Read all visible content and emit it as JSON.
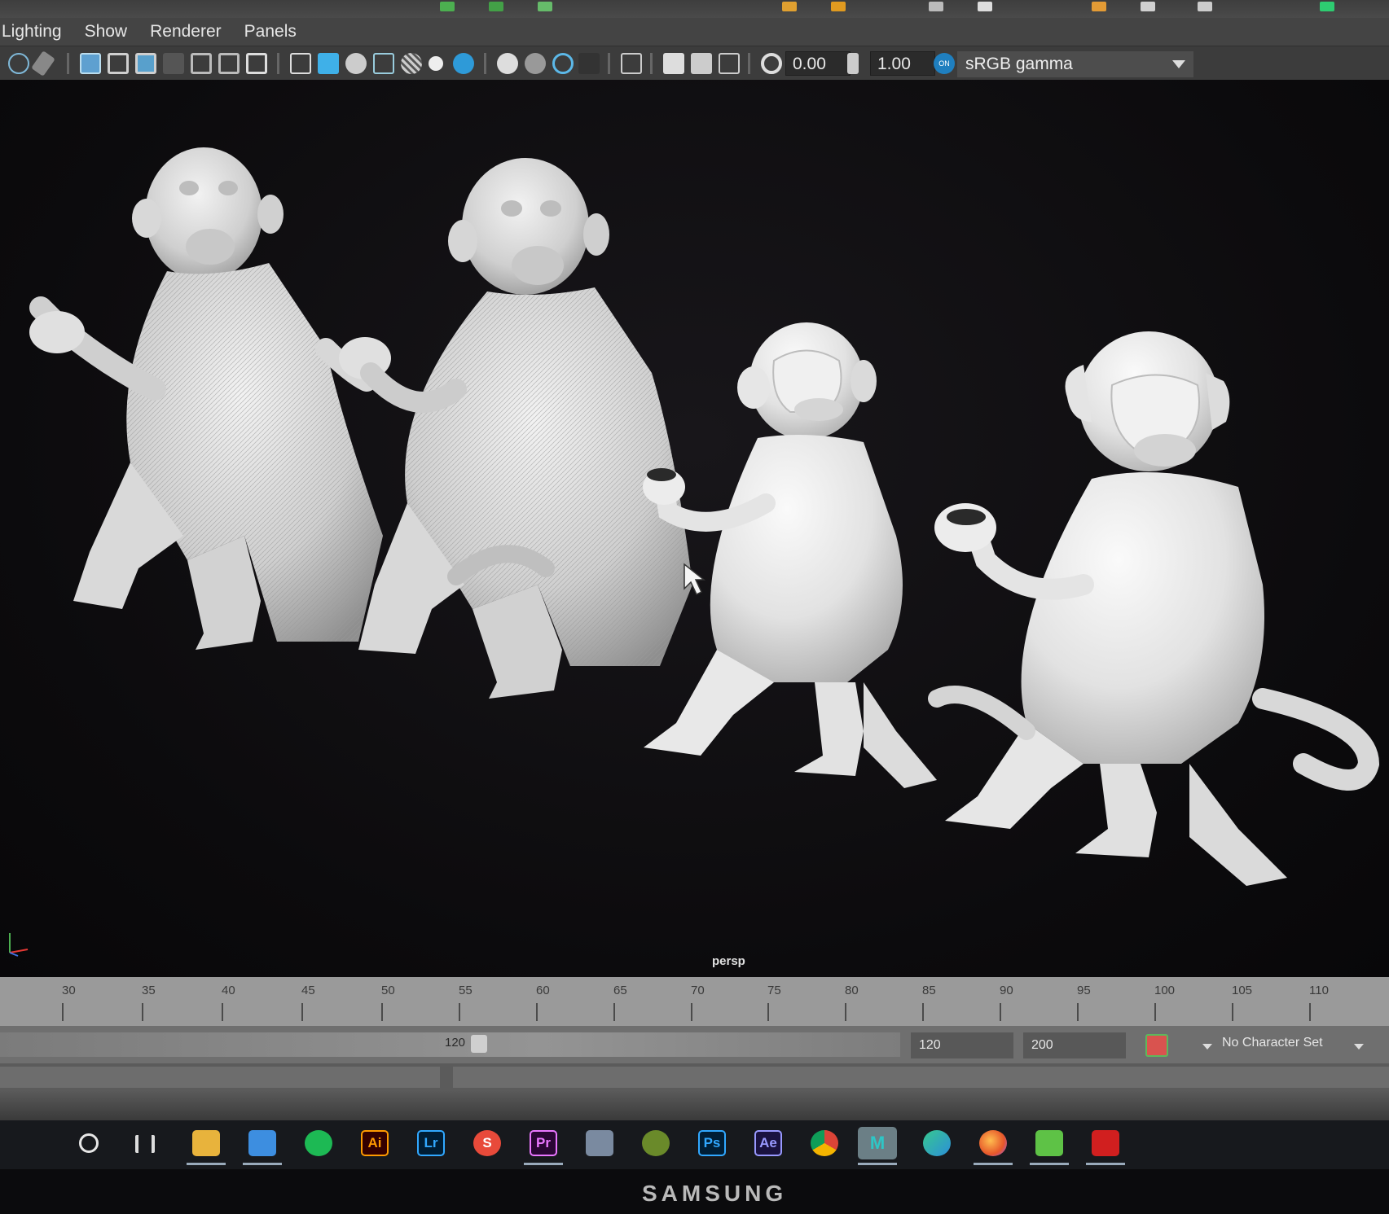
{
  "menu": {
    "items": [
      "Lighting",
      "Show",
      "Renderer",
      "Panels"
    ]
  },
  "toolbar": {
    "exposure_value": "0.00",
    "gamma_value": "1.00",
    "colorspace_badge": "ON",
    "colorspace": "sRGB gamma",
    "icons": [
      "select-camera-icon",
      "camera-attributes-icon",
      "grid-icon",
      "film-gate-icon",
      "resolution-gate-icon",
      "field-chart-icon",
      "safe-action-icon",
      "safe-title-icon",
      "wireframe-icon",
      "smooth-shade-icon",
      "default-material-icon",
      "textured-icon",
      "wireframe-on-shaded-icon",
      "lights-icon",
      "shadows-icon",
      "ambient-occlusion-icon",
      "motion-blur-icon",
      "anti-aliasing-icon",
      "depth-of-field-icon",
      "isolate-select-icon",
      "xray-icon",
      "xray-joints-icon",
      "xray-components-icon",
      "exposure-icon",
      "gamma-icon",
      "color-management-icon"
    ]
  },
  "viewport": {
    "camera_label": "persp",
    "background_color": "#0d0c0e"
  },
  "timeline": {
    "ticks": [
      "30",
      "35",
      "40",
      "45",
      "50",
      "55",
      "60",
      "65",
      "70",
      "75",
      "80",
      "85",
      "90",
      "95",
      "100",
      "105",
      "110"
    ]
  },
  "range": {
    "handle_value": "120",
    "end_value": "120",
    "anim_end_value": "200",
    "character_set": "No Character Set"
  },
  "taskbar": {
    "icons": [
      {
        "name": "cortana-icon",
        "label": "",
        "color": "#17191d"
      },
      {
        "name": "task-view-icon",
        "label": "",
        "color": "#17191d"
      },
      {
        "name": "file-explorer-icon",
        "label": "",
        "color": "#e8b33c"
      },
      {
        "name": "mail-icon",
        "label": "",
        "color": "#3d8ee0"
      },
      {
        "name": "spotify-icon",
        "label": "",
        "color": "#1db954"
      },
      {
        "name": "illustrator-icon",
        "label": "Ai",
        "color": "#330000"
      },
      {
        "name": "lightroom-icon",
        "label": "Lr",
        "color": "#001d34"
      },
      {
        "name": "substance-icon",
        "label": "S",
        "color": "#e84a3a"
      },
      {
        "name": "premiere-icon",
        "label": "Pr",
        "color": "#2a0634"
      },
      {
        "name": "paint-tool-icon",
        "label": "",
        "color": "#7a8aa0"
      },
      {
        "name": "game-icon",
        "label": "",
        "color": "#6a8a2a"
      },
      {
        "name": "photoshop-icon",
        "label": "Ps",
        "color": "#001e36"
      },
      {
        "name": "after-effects-icon",
        "label": "Ae",
        "color": "#1a1240"
      },
      {
        "name": "chrome-icon",
        "label": "",
        "color": "#e0b02a"
      },
      {
        "name": "maya-icon",
        "label": "M",
        "color": "#6b7f86"
      },
      {
        "name": "edge-icon",
        "label": "",
        "color": "#2c8fd9"
      },
      {
        "name": "firefox-icon",
        "label": "",
        "color": "#e6572a"
      },
      {
        "name": "notes-icon",
        "label": "",
        "color": "#5ec246"
      },
      {
        "name": "acrobat-icon",
        "label": "",
        "color": "#d11f1f"
      }
    ]
  },
  "bezel": {
    "brand": "SAMSUNG"
  }
}
